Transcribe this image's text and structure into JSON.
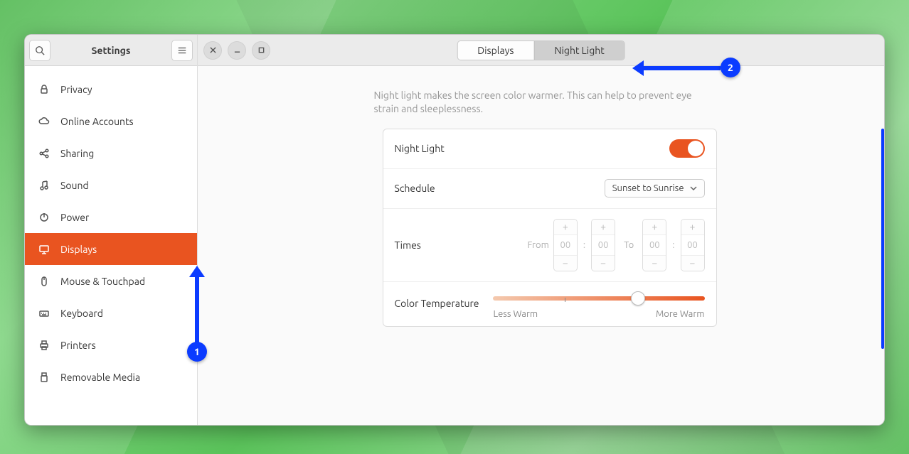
{
  "sidebar": {
    "title": "Settings",
    "items": [
      {
        "icon": "lock",
        "label": "Privacy"
      },
      {
        "icon": "cloud",
        "label": "Online Accounts"
      },
      {
        "icon": "share",
        "label": "Sharing"
      },
      {
        "icon": "music",
        "label": "Sound"
      },
      {
        "icon": "power",
        "label": "Power"
      },
      {
        "icon": "display",
        "label": "Displays",
        "selected": true
      },
      {
        "icon": "mouse",
        "label": "Mouse & Touchpad"
      },
      {
        "icon": "keyboard",
        "label": "Keyboard"
      },
      {
        "icon": "printer",
        "label": "Printers"
      },
      {
        "icon": "usb",
        "label": "Removable Media"
      }
    ]
  },
  "header": {
    "tabs": {
      "displays": "Displays",
      "night_light": "Night Light"
    },
    "active_tab": "night_light"
  },
  "night_light": {
    "description": "Night light makes the screen color warmer. This can help to prevent eye strain and sleeplessness.",
    "toggle_label": "Night Light",
    "toggle_on": true,
    "schedule_label": "Schedule",
    "schedule_value": "Sunset to Sunrise",
    "times_label": "Times",
    "from_label": "From",
    "to_label": "To",
    "from_h": "00",
    "from_m": "00",
    "to_h": "00",
    "to_m": "00",
    "temp_label": "Color Temperature",
    "less_warm": "Less Warm",
    "more_warm": "More Warm"
  },
  "annotations": {
    "marker1": "1",
    "marker2": "2"
  }
}
